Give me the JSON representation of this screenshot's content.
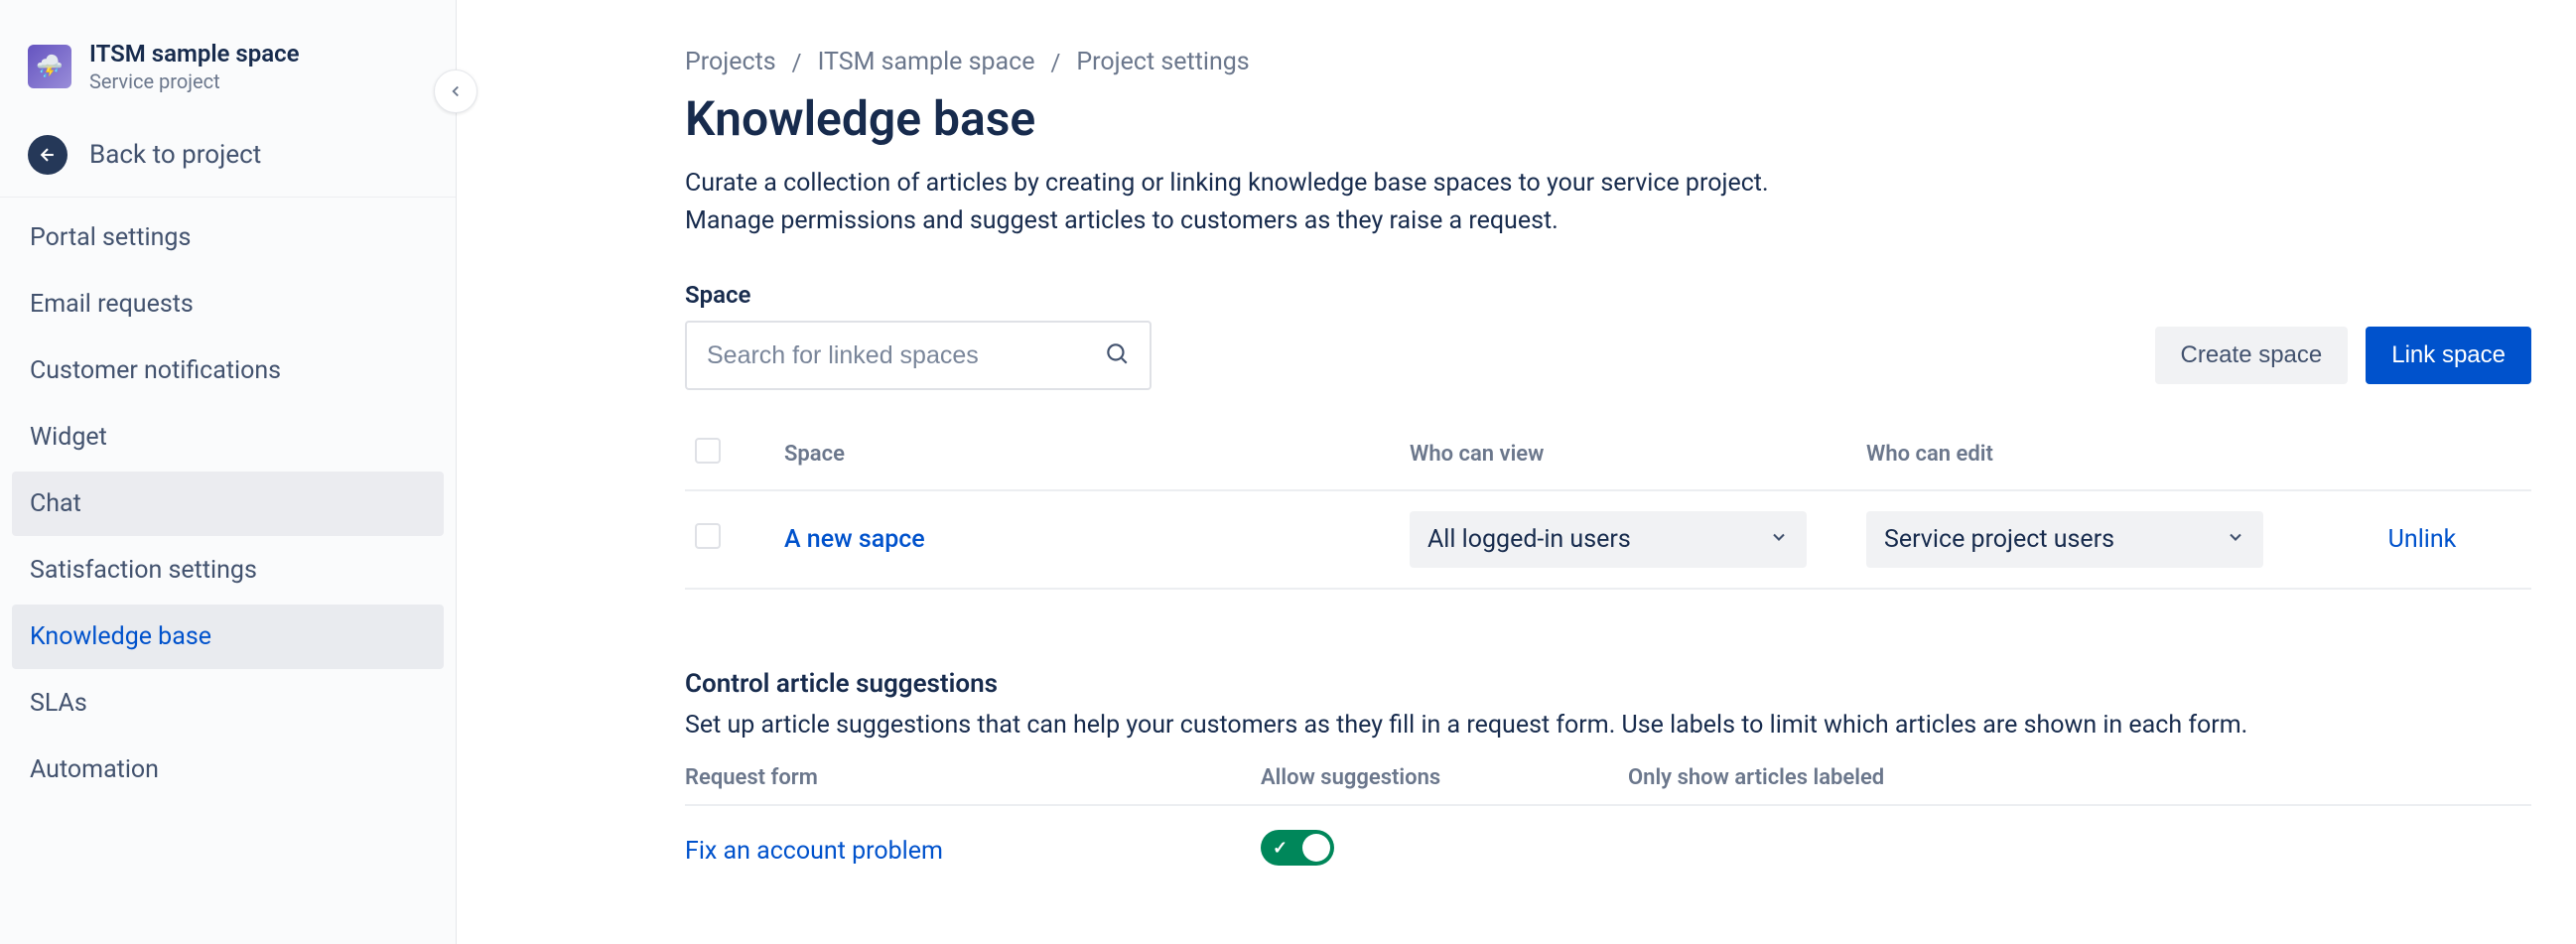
{
  "project": {
    "name": "ITSM sample space",
    "type": "Service project",
    "back_label": "Back to project"
  },
  "sidebar": {
    "items": [
      {
        "label": "Portal settings"
      },
      {
        "label": "Email requests"
      },
      {
        "label": "Customer notifications"
      },
      {
        "label": "Widget"
      },
      {
        "label": "Chat"
      },
      {
        "label": "Satisfaction settings"
      },
      {
        "label": "Knowledge base"
      },
      {
        "label": "SLAs"
      },
      {
        "label": "Automation"
      }
    ],
    "hover_index": 4,
    "active_index": 6
  },
  "breadcrumbs": {
    "a": "Projects",
    "b": "ITSM sample space",
    "c": "Project settings"
  },
  "page": {
    "title": "Knowledge base",
    "lead1": "Curate a collection of articles by creating or linking knowledge base spaces to your service project.",
    "lead2": "Manage permissions and suggest articles to customers as they raise a request."
  },
  "space_section": {
    "label": "Space",
    "search_placeholder": "Search for linked spaces",
    "create_btn": "Create space",
    "link_btn": "Link space",
    "columns": {
      "space": "Space",
      "view": "Who can view",
      "edit": "Who can edit"
    },
    "row": {
      "name": "A new sapce",
      "view": "All logged-in users",
      "edit": "Service project users",
      "unlink": "Unlink"
    }
  },
  "suggestions": {
    "title": "Control article suggestions",
    "desc": "Set up article suggestions that can help your customers as they fill in a request form. Use labels to limit which articles are shown in each form.",
    "columns": {
      "form": "Request form",
      "allow": "Allow suggestions",
      "labeled": "Only show articles labeled"
    },
    "row": {
      "form": "Fix an account problem",
      "allow": true
    }
  }
}
